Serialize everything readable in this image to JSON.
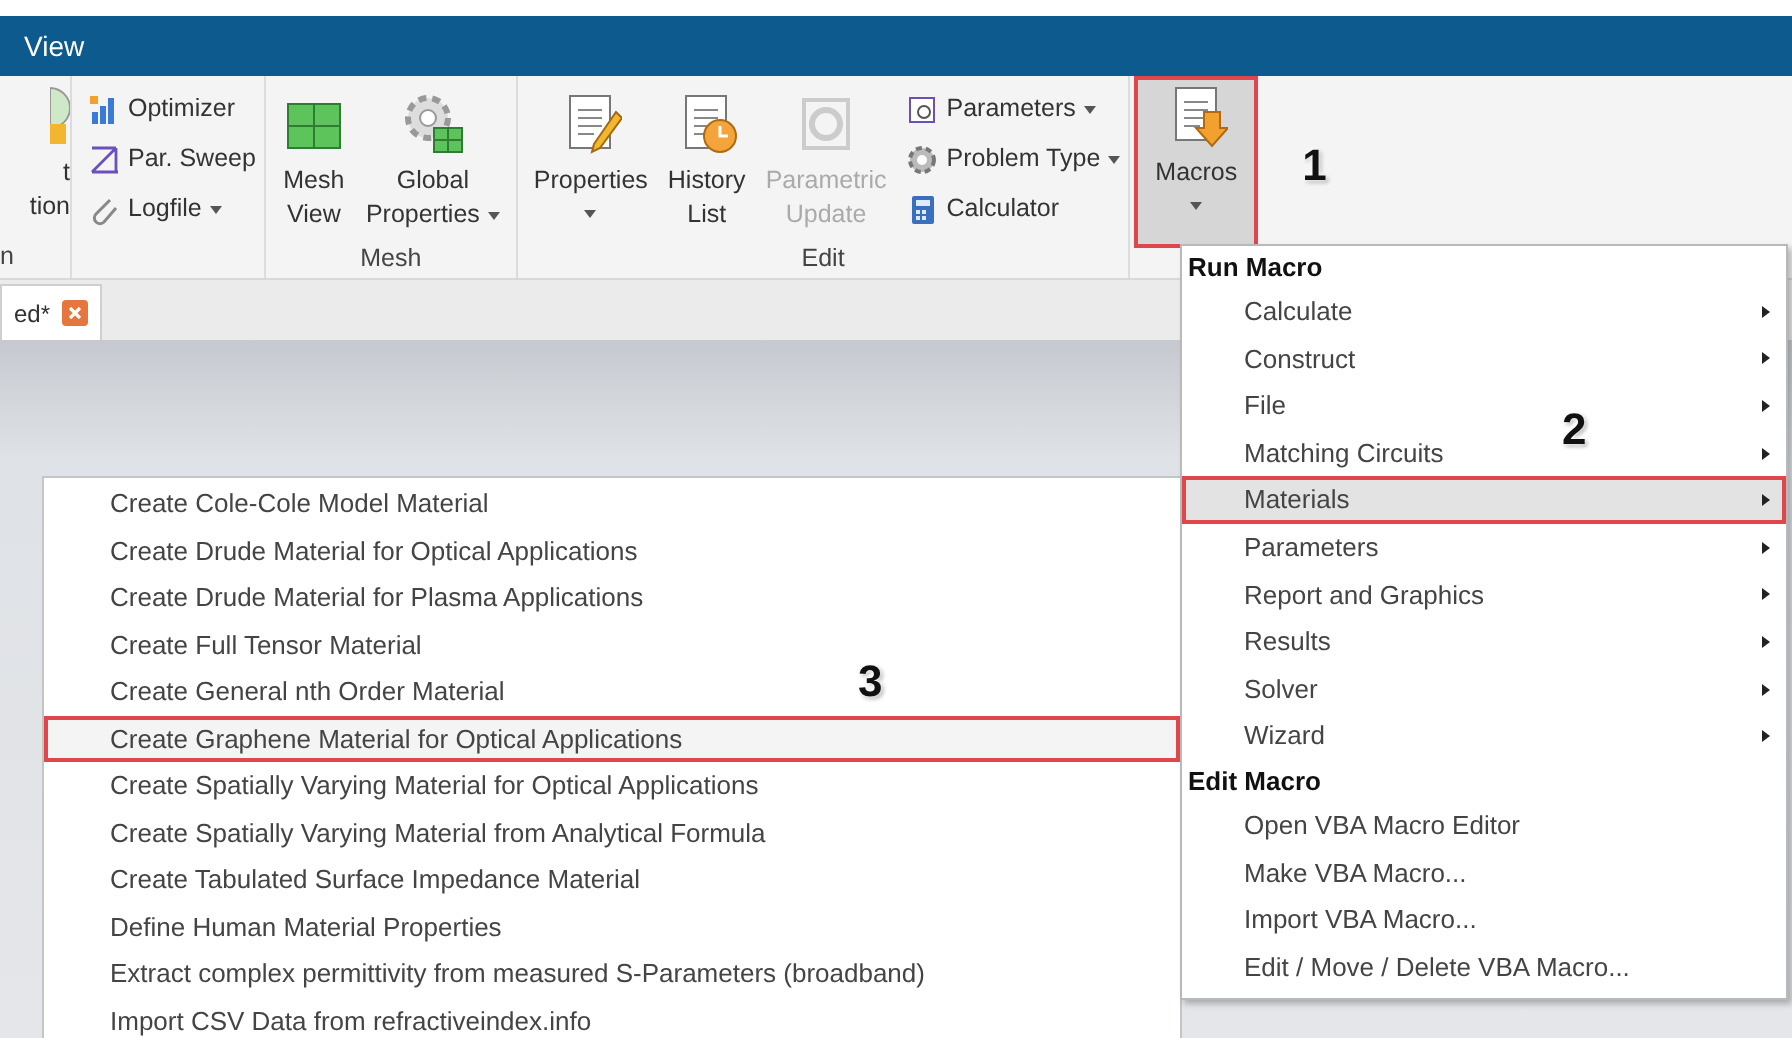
{
  "window": {
    "title": "View"
  },
  "ribbon": {
    "groups": [
      {
        "label": "n",
        "items": [
          {
            "kind": "large",
            "lines": [
              "t",
              "tion"
            ],
            "dropdown": false,
            "disabled": false
          }
        ]
      },
      {
        "items": [
          {
            "kind": "small",
            "label": "Optimizer",
            "dropdown": false,
            "disabled": false
          },
          {
            "kind": "small",
            "label": "Par. Sweep",
            "dropdown": false,
            "disabled": false
          },
          {
            "kind": "small",
            "label": "Logfile",
            "dropdown": true,
            "disabled": false
          }
        ]
      },
      {
        "label": "Mesh",
        "items": [
          {
            "kind": "large",
            "lines": [
              "Mesh",
              "View"
            ],
            "dropdown": false,
            "disabled": false
          },
          {
            "kind": "large",
            "lines": [
              "Global",
              "Properties"
            ],
            "dropdown": true,
            "disabled": false
          }
        ]
      },
      {
        "label": "Edit",
        "items": [
          {
            "kind": "large",
            "lines": [
              "Properties"
            ],
            "dropdown": true,
            "disabled": false
          },
          {
            "kind": "large",
            "lines": [
              "History",
              "List"
            ],
            "dropdown": false,
            "disabled": false
          },
          {
            "kind": "large",
            "lines": [
              "Parametric",
              "Update"
            ],
            "dropdown": false,
            "disabled": true
          },
          {
            "kind": "small",
            "label": "Parameters",
            "dropdown": true,
            "disabled": false
          },
          {
            "kind": "small",
            "label": "Problem Type",
            "dropdown": true,
            "disabled": false
          },
          {
            "kind": "small",
            "label": "Calculator",
            "dropdown": false,
            "disabled": false
          }
        ]
      },
      {
        "items": [
          {
            "kind": "large",
            "lines": [
              "Macros"
            ],
            "dropdown": true,
            "disabled": false,
            "pressed": true,
            "highlighted": true,
            "callout": "1"
          }
        ]
      }
    ]
  },
  "tabs": [
    {
      "label": "ed*"
    }
  ],
  "macros_menu": [
    {
      "kind": "header",
      "label": "Run Macro"
    },
    {
      "kind": "item",
      "label": "Calculate",
      "submenu": true,
      "selected": false,
      "highlighted": false
    },
    {
      "kind": "item",
      "label": "Construct",
      "submenu": true,
      "selected": false,
      "highlighted": false
    },
    {
      "kind": "item",
      "label": "File",
      "submenu": true,
      "selected": false,
      "highlighted": false
    },
    {
      "kind": "item",
      "label": "Matching Circuits",
      "submenu": true,
      "selected": false,
      "highlighted": false
    },
    {
      "kind": "item",
      "label": "Materials",
      "submenu": true,
      "selected": true,
      "highlighted": true,
      "callout": "2"
    },
    {
      "kind": "item",
      "label": "Parameters",
      "submenu": true,
      "selected": false,
      "highlighted": false
    },
    {
      "kind": "item",
      "label": "Report and Graphics",
      "submenu": true,
      "selected": false,
      "highlighted": false
    },
    {
      "kind": "item",
      "label": "Results",
      "submenu": true,
      "selected": false,
      "highlighted": false
    },
    {
      "kind": "item",
      "label": "Solver",
      "submenu": true,
      "selected": false,
      "highlighted": false
    },
    {
      "kind": "item",
      "label": "Wizard",
      "submenu": true,
      "selected": false,
      "highlighted": false
    },
    {
      "kind": "header",
      "label": "Edit Macro"
    },
    {
      "kind": "item",
      "label": "Open VBA Macro Editor",
      "submenu": false,
      "selected": false,
      "highlighted": false
    },
    {
      "kind": "item",
      "label": "Make VBA Macro...",
      "submenu": false,
      "selected": false,
      "highlighted": false
    },
    {
      "kind": "item",
      "label": "Import VBA Macro...",
      "submenu": false,
      "selected": false,
      "highlighted": false
    },
    {
      "kind": "item",
      "label": "Edit / Move / Delete VBA Macro...",
      "submenu": false,
      "selected": false,
      "highlighted": false
    }
  ],
  "materials_submenu": [
    {
      "label": "Create Cole-Cole Model Material",
      "highlighted": false
    },
    {
      "label": "Create Drude Material for Optical Applications",
      "highlighted": false
    },
    {
      "label": "Create Drude Material for Plasma Applications",
      "highlighted": false
    },
    {
      "label": "Create Full Tensor Material",
      "highlighted": false
    },
    {
      "label": "Create General nth Order Material",
      "highlighted": false
    },
    {
      "label": "Create Graphene Material for Optical Applications",
      "highlighted": true,
      "callout": "3"
    },
    {
      "label": "Create Spatially Varying Material for Optical Applications",
      "highlighted": false
    },
    {
      "label": "Create Spatially Varying Material from Analytical Formula",
      "highlighted": false
    },
    {
      "label": "Create Tabulated Surface Impedance Material",
      "highlighted": false
    },
    {
      "label": "Define Human Material Properties",
      "highlighted": false
    },
    {
      "label": "Extract complex permittivity from measured S-Parameters (broadband)",
      "highlighted": false
    },
    {
      "label": "Import CSV Data from refractiveindex.info",
      "highlighted": false
    }
  ]
}
